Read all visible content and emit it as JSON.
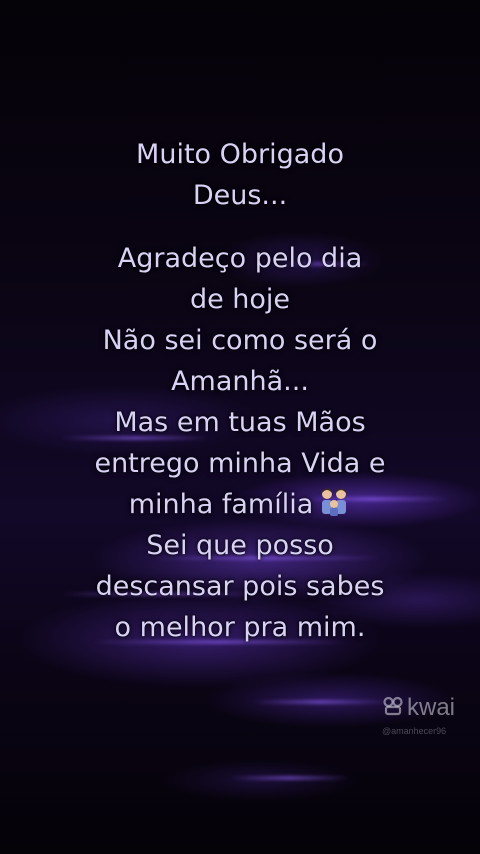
{
  "message": {
    "title_lines": [
      "Muito Obrigado",
      "Deus..."
    ],
    "body_lines": [
      "Agradeço pelo dia",
      "de hoje",
      "Não sei como será o",
      "Amanhã...",
      "Mas em tuas Mãos",
      "entrego minha Vida e",
      "minha família",
      "Sei que posso",
      "descansar pois sabes",
      "o melhor pra mim."
    ],
    "emoji_icon": "family-emoji-icon"
  },
  "watermark": {
    "brand": "kwai",
    "logo_icon": "kwai-logo-icon",
    "handle": "@amanhecer96"
  },
  "colors": {
    "text": "#d9d2f5",
    "accent": "#7a45e0",
    "background": "#0b0515"
  }
}
